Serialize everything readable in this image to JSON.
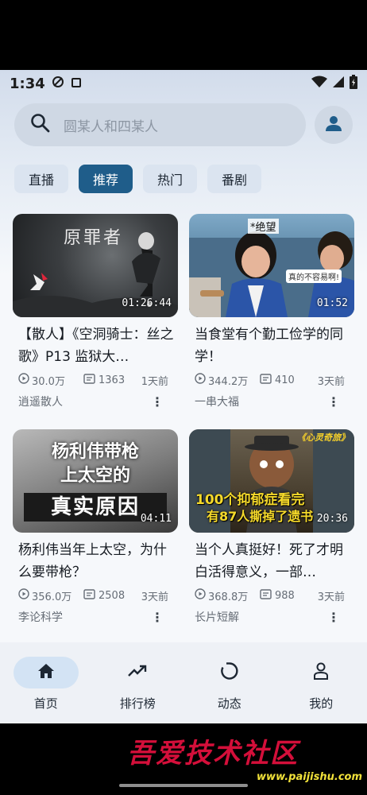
{
  "status": {
    "time": "1:34"
  },
  "search": {
    "placeholder": "圆某人和四某人"
  },
  "tabs": [
    {
      "label": "直播",
      "active": false
    },
    {
      "label": "推荐",
      "active": true
    },
    {
      "label": "热门",
      "active": false
    },
    {
      "label": "番剧",
      "active": false
    }
  ],
  "videos": [
    {
      "thumb_text": "原罪者",
      "duration": "01:26:44",
      "title": "【散人】《空洞骑士：丝之歌》P13 监狱大…",
      "views": "30.0万",
      "danmaku": "1363",
      "time_ago": "1天前",
      "author": "逍遥散人"
    },
    {
      "thumb_text": "*绝望",
      "thumb_caption": "真的不容易啊!",
      "duration": "01:52",
      "title": "当食堂有个勤工俭学的同学！",
      "views": "344.2万",
      "danmaku": "410",
      "time_ago": "3天前",
      "author": "一串大福"
    },
    {
      "thumb_line1": "杨利伟带枪",
      "thumb_line2": "上太空的",
      "thumb_line3": "真实原因",
      "duration": "04:11",
      "title": "杨利伟当年上太空，为什么要带枪？",
      "views": "356.0万",
      "danmaku": "2508",
      "time_ago": "3天前",
      "author": "李论科学"
    },
    {
      "thumb_tag": "《心灵奇旅》",
      "thumb_line1": "100个抑郁症看完",
      "thumb_line2": "有87人撕掉了遗书",
      "duration": "20:36",
      "title": "当个人真挺好！死了才明白活得意义，一部…",
      "views": "368.8万",
      "danmaku": "988",
      "time_ago": "3天前",
      "author": "长片短解"
    }
  ],
  "nav": [
    {
      "label": "首页",
      "icon": "home-icon",
      "active": true
    },
    {
      "label": "排行榜",
      "icon": "trending-icon",
      "active": false
    },
    {
      "label": "动态",
      "icon": "refresh-icon",
      "active": false
    },
    {
      "label": "我的",
      "icon": "person-icon",
      "active": false
    }
  ],
  "watermark": {
    "text": "吾爱技术社区",
    "url": "www.paijishu.com"
  },
  "colors": {
    "accent": "#1f5d8a",
    "tab_bg": "#dbe4f0",
    "nav_active": "#d3e3f4"
  }
}
